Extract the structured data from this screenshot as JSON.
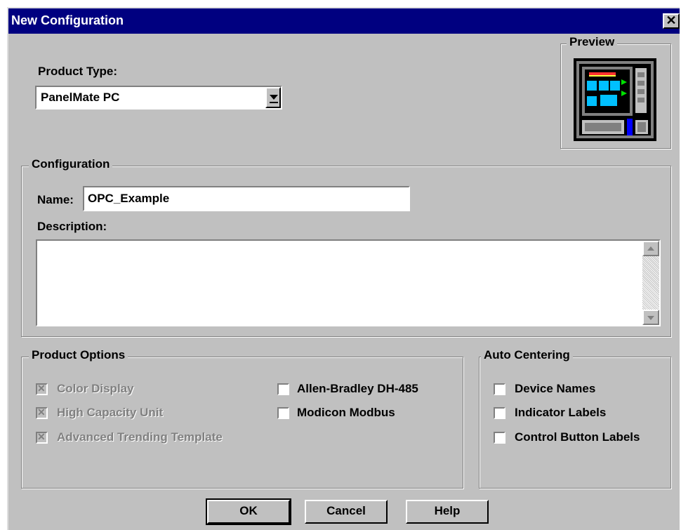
{
  "window": {
    "title": "New Configuration",
    "close_glyph": "✕"
  },
  "product_type": {
    "label": "Product Type:",
    "value": "PanelMate PC"
  },
  "preview": {
    "label": "Preview",
    "icon": "panel-device-icon"
  },
  "configuration": {
    "group_label": "Configuration",
    "name_label": "Name:",
    "name_value": "OPC_Example",
    "description_label": "Description:",
    "description_value": ""
  },
  "product_options": {
    "group_label": "Product Options",
    "items": [
      {
        "label": "Color Display",
        "checked": true,
        "enabled": false
      },
      {
        "label": "High Capacity Unit",
        "checked": true,
        "enabled": false
      },
      {
        "label": "Advanced Trending Template",
        "checked": true,
        "enabled": false
      },
      {
        "label": "Allen-Bradley DH-485",
        "checked": false,
        "enabled": true
      },
      {
        "label": "Modicon Modbus",
        "checked": false,
        "enabled": true
      }
    ]
  },
  "auto_centering": {
    "group_label": "Auto Centering",
    "items": [
      {
        "label": "Device Names",
        "checked": false
      },
      {
        "label": "Indicator Labels",
        "checked": false
      },
      {
        "label": "Control Button Labels",
        "checked": false
      }
    ]
  },
  "buttons": {
    "ok": "OK",
    "cancel": "Cancel",
    "help": "Help"
  },
  "colors": {
    "titlebar": "#000080",
    "face": "#c0c0c0",
    "disabled_text": "#808080"
  }
}
